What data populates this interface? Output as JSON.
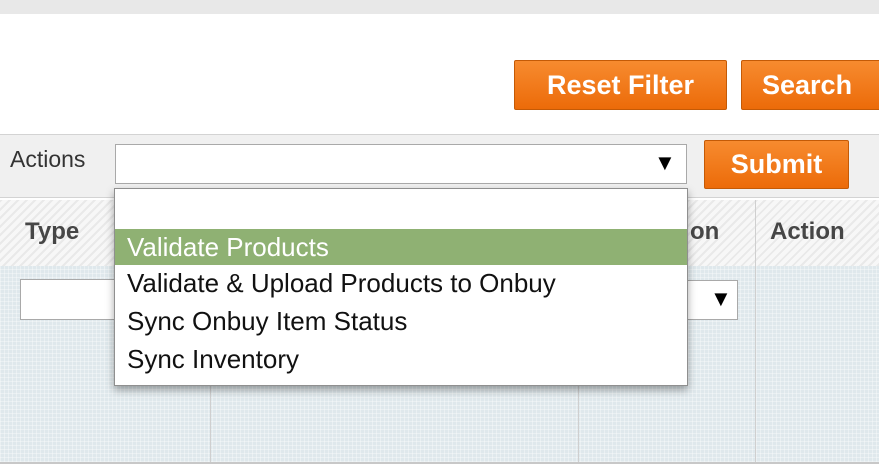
{
  "toolbar": {
    "reset_filter_label": "Reset Filter",
    "search_label": "Search"
  },
  "actions": {
    "label": "Actions",
    "selected_value": "",
    "submit_label": "Submit",
    "arrow": "▼",
    "options": [
      "",
      "Validate Products",
      "Validate & Upload Products to Onbuy",
      "Sync Onbuy Item Status",
      "Sync Inventory"
    ],
    "highlighted_option": "Validate Products"
  },
  "grid": {
    "columns": [
      "Type",
      "on",
      "Action"
    ],
    "filter_arrow": "▼"
  },
  "colors": {
    "button_orange": "#ec6b09",
    "highlight_green": "#8fb173",
    "grid_body": "#dfe8ec"
  }
}
